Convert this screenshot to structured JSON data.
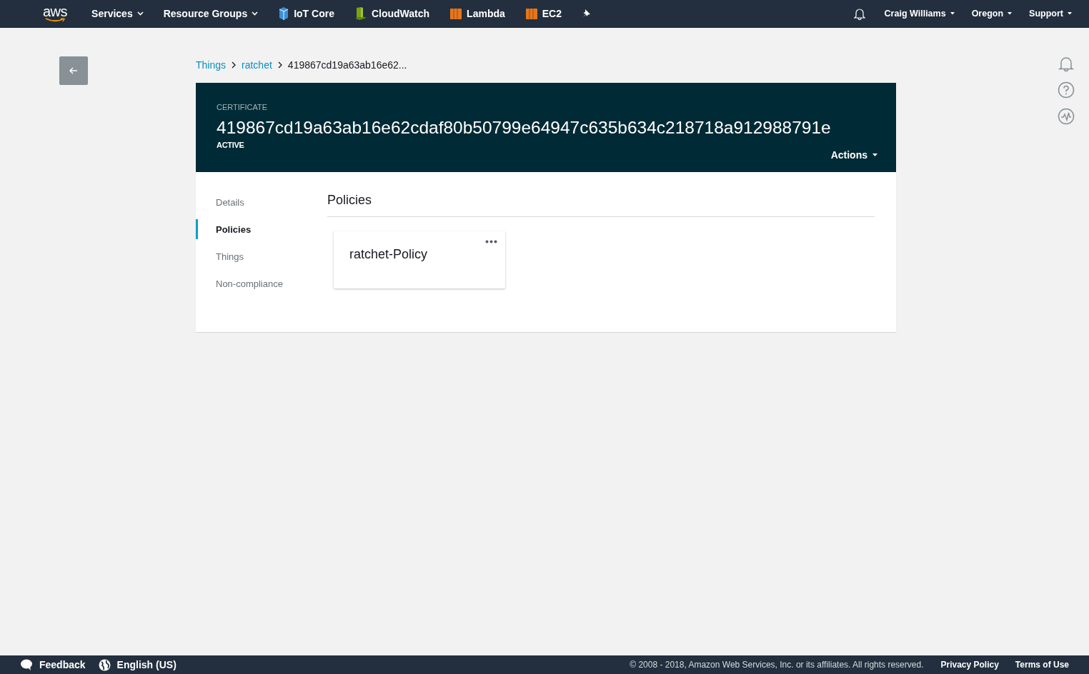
{
  "top_bar": {
    "logo": "aws",
    "menus": [
      {
        "label": "Services"
      },
      {
        "label": "Resource Groups"
      }
    ],
    "shortcuts": [
      {
        "label": "IoT Core",
        "kind": "iot"
      },
      {
        "label": "CloudWatch",
        "kind": "cloudwatch"
      },
      {
        "label": "Lambda",
        "kind": "lambda"
      },
      {
        "label": "EC2",
        "kind": "ec2"
      }
    ],
    "account_menus": [
      {
        "label": "Craig Williams"
      },
      {
        "label": "Oregon"
      },
      {
        "label": "Support"
      }
    ]
  },
  "breadcrumb": [
    {
      "label": "Things",
      "kind": "link"
    },
    {
      "label": "ratchet",
      "kind": "link"
    },
    {
      "label": "419867cd19a63ab16e62...",
      "kind": "current"
    }
  ],
  "header": {
    "type_label": "CERTIFICATE",
    "title": "419867cd19a63ab16e62cdaf80b50799e64947c635b634c218718a912988791e",
    "status": "ACTIVE",
    "actions": "Actions"
  },
  "side_nav": [
    {
      "label": "Details",
      "selected": false
    },
    {
      "label": "Policies",
      "selected": true
    },
    {
      "label": "Things",
      "selected": false
    },
    {
      "label": "Non-compliance",
      "selected": false
    }
  ],
  "section": {
    "title": "Policies",
    "cards": [
      {
        "name": "ratchet-Policy"
      }
    ]
  },
  "footer": {
    "feedback": "Feedback",
    "language": "English (US)",
    "copyright": "© 2008 - 2018, Amazon Web Services, Inc. or its affiliates. All rights reserved.",
    "links": [
      "Privacy Policy",
      "Terms of Use"
    ]
  }
}
